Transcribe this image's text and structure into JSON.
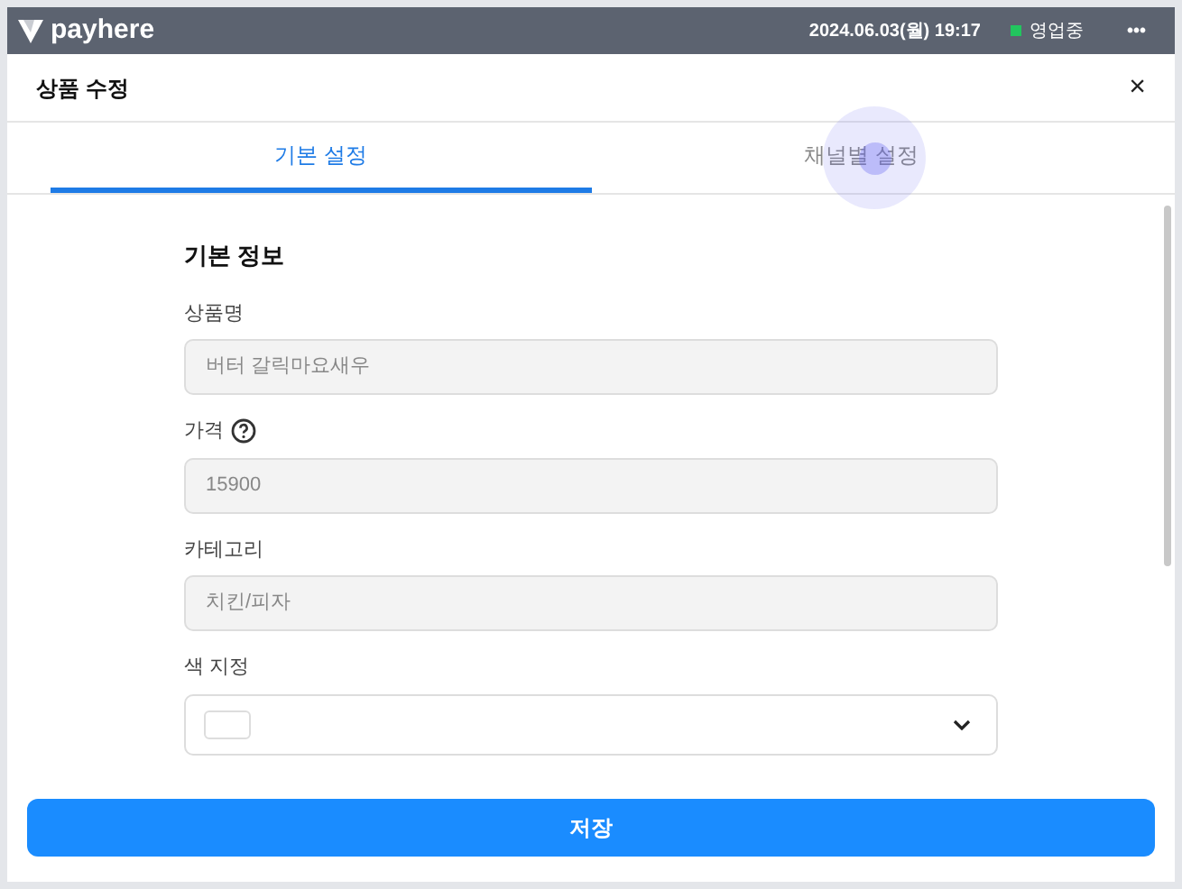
{
  "top_bar": {
    "brand": "payhere",
    "datetime": "2024.06.03(월) 19:17",
    "status": {
      "label": "영업중",
      "color": "#22c55e"
    },
    "menu": "•••"
  },
  "dialog": {
    "title": "상품 수정",
    "close": "×"
  },
  "tabs": [
    {
      "label": "기본 설정",
      "selected": true
    },
    {
      "label": "채널별 설정",
      "selected": false
    }
  ],
  "section": {
    "title": "기본 정보",
    "fields": [
      {
        "kind": "text",
        "label": "상품명",
        "value": "버터 갈릭마요새우",
        "help": false
      },
      {
        "kind": "text",
        "label": "가격",
        "value": "15900",
        "help": true
      },
      {
        "kind": "text",
        "label": "카테고리",
        "value": "치킨/피자",
        "help": false
      },
      {
        "kind": "color",
        "label": "색 지정",
        "color": "#ffffff",
        "help": false
      }
    ]
  },
  "save_button": "저장"
}
